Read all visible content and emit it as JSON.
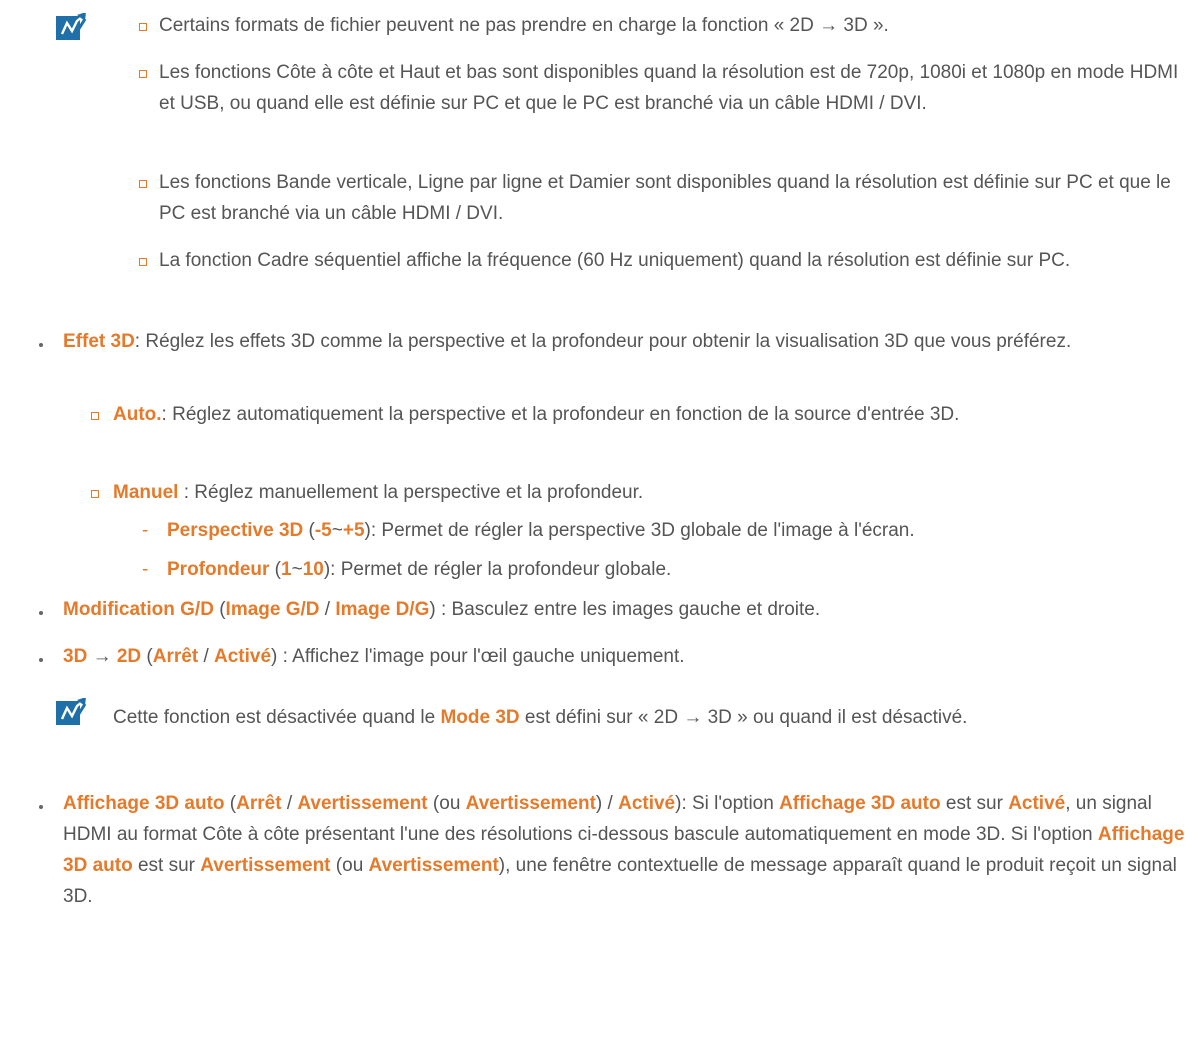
{
  "note1": {
    "items": [
      "Certains formats de fichier peuvent ne pas prendre en charge la fonction « 2D → 3D ».",
      "Les fonctions Côte à côte et Haut et bas sont disponibles quand la résolution est de 720p, 1080i et 1080p en mode HDMI et USB, ou quand elle est définie sur PC et que le PC est branché via un câble HDMI / DVI.",
      "Les fonctions Bande verticale, Ligne par ligne et Damier sont disponibles quand la résolution est définie sur PC et que le PC est branché via un câble HDMI / DVI.",
      "La fonction Cadre séquentiel affiche la fréquence (60 Hz uniquement) quand la résolution est définie sur PC."
    ]
  },
  "effet": {
    "term": "Effet 3D",
    "desc": ": Réglez les effets 3D comme la perspective et la profondeur pour obtenir la visualisation 3D que vous préférez.",
    "auto_term": "Auto.",
    "auto_desc": ": Réglez automatiquement la perspective et la profondeur en fonction de la source d'entrée 3D.",
    "manuel_term": "Manuel",
    "manuel_desc": " : Réglez manuellement la perspective et la profondeur.",
    "persp_term": "Perspective 3D",
    "persp_open": " (",
    "persp_min": "-5",
    "persp_tilde": "~",
    "persp_max": "+5",
    "persp_desc": "): Permet de régler la perspective 3D globale de l'image à l'écran.",
    "prof_term": "Profondeur",
    "prof_open": " (",
    "prof_min": "1",
    "prof_tilde": "~",
    "prof_max": "10",
    "prof_desc": "): Permet de régler la profondeur globale."
  },
  "modif": {
    "term": "Modification G/D",
    "open": " (",
    "opt1": "Image G/D",
    "sep": " / ",
    "opt2": "Image D/G",
    "desc": ") : Basculez entre les images gauche et droite."
  },
  "td": {
    "term1": "3D",
    "arrow": " → ",
    "term2": "2D",
    "open": " (",
    "opt1": "Arrêt",
    "sep": " / ",
    "opt2": "Activé",
    "desc": ") : Affichez l'image pour l'œil gauche uniquement."
  },
  "note2": {
    "pre": "Cette fonction est désactivée quand le ",
    "term": "Mode 3D",
    "post": " est défini sur « 2D → 3D » ou quand il est désactivé."
  },
  "aff": {
    "term": "Affichage 3D auto",
    "open": " (",
    "opt1": "Arrêt",
    "sep1": " / ",
    "opt2": "Avertissement",
    "paren_open": " (ou ",
    "opt3": "Avertissement",
    "paren_close": ") / ",
    "opt4": "Activé",
    "t1": "): Si l'option ",
    "term2": "Affichage 3D auto",
    "t2": " est sur ",
    "opt5": "Activé",
    "t3": ", un signal HDMI au format Côte à côte présentant l'une des résolutions ci-dessous bascule automatiquement en mode 3D. Si l'option ",
    "term3": "Affichage 3D auto",
    "t4": " est sur ",
    "opt6": "Avertissement",
    "t5": " (ou ",
    "opt7": "Avertissement",
    "t6": "), une fenêtre contextuelle de message apparaît quand le produit reçoit un signal 3D."
  }
}
